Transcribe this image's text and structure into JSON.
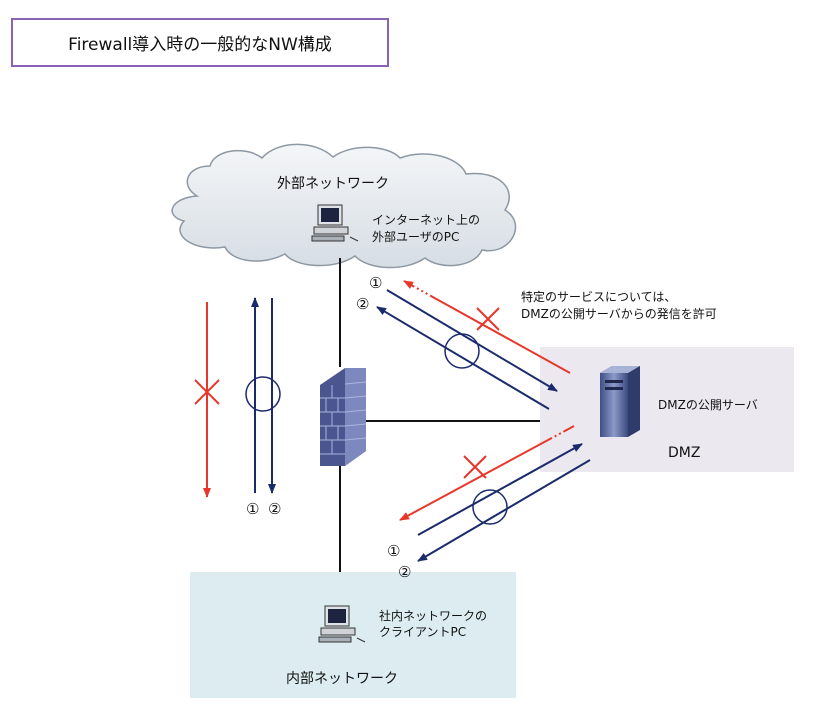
{
  "title": "Firewall導入時の一般的なNW構成",
  "zones": {
    "external": "外部ネットワーク",
    "dmz": "DMZ",
    "internal": "内部ネットワーク"
  },
  "nodes": {
    "external_pc_line1": "インターネット上の",
    "external_pc_line2": "外部ユーザのPC",
    "dmz_server": "DMZの公開サーバ",
    "internal_pc_line1": "社内ネットワークの",
    "internal_pc_line2": "クライアントPC"
  },
  "note": {
    "line1": "特定のサービスについては、",
    "line2": "DMZの公開サーバからの発信を許可"
  },
  "markers": {
    "one": "①",
    "two": "②"
  },
  "colors": {
    "allowed_flow": "#1a2a6c",
    "blocked_flow": "#e8372a",
    "title_border": "#8a63b5",
    "dmz_zone": "#ece8f0",
    "internal_zone": "#dcecf0"
  },
  "icons": [
    "cloud-icon",
    "pc-icon",
    "firewall-icon",
    "server-icon",
    "allow-circle-icon",
    "block-x-icon"
  ]
}
